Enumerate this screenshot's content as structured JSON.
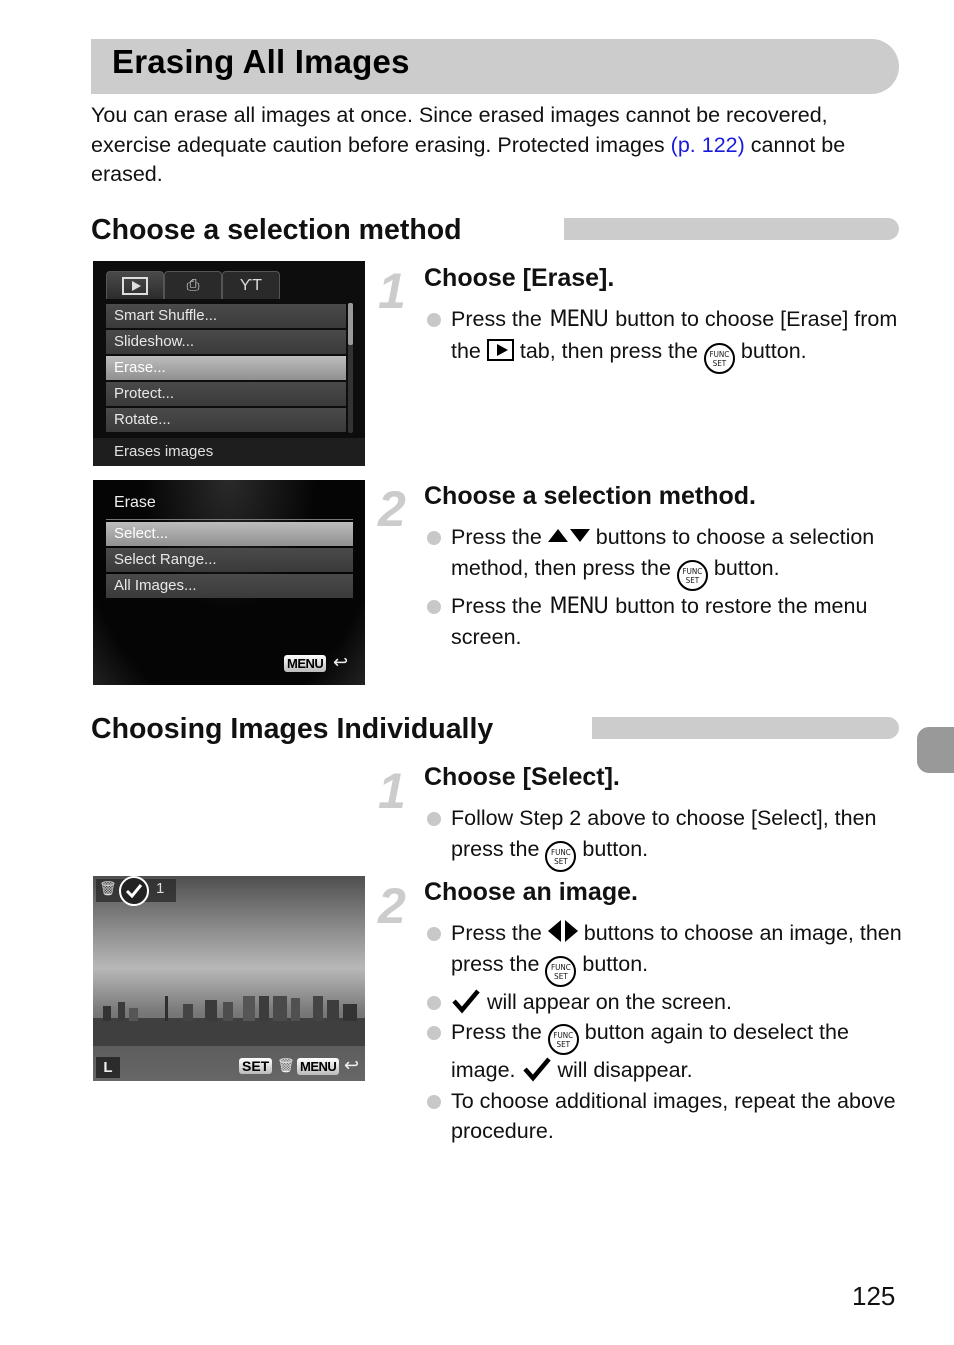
{
  "page": {
    "title": "Erasing All Images",
    "intro_part1": "You can erase all images at once. Since erased images cannot be recovered, exercise adequate caution before erasing. Protected images ",
    "intro_link": "(p. 122)",
    "intro_part2": " cannot be erased.",
    "page_number": "125"
  },
  "colors": {
    "link": "#1a1adc",
    "title_bar": "#cccccc",
    "side_tab": "#999999",
    "step_number": "#cccccc"
  },
  "section1": {
    "heading": "Choose a selection method",
    "steps": [
      {
        "number": "1",
        "title": "Choose [Erase].",
        "bullets": [
          {
            "a": "Press the ",
            "menu": "MENU",
            "b": " button to choose [Erase] from the ",
            "c": " tab, then press the ",
            "d": " button."
          }
        ]
      },
      {
        "number": "2",
        "title": "Choose a selection method.",
        "bullets": [
          {
            "a": "Press the ",
            "b": " buttons to choose a selection method, then press the ",
            "c": " button."
          },
          {
            "a": "Press the ",
            "menu": "MENU",
            "b": " button to restore the menu screen."
          }
        ]
      }
    ],
    "screen1": {
      "tabs": [
        "play-tab",
        "print-tab",
        "settings-tab"
      ],
      "tab_icons": {
        "print": "⎙",
        "settings": "ƳT"
      },
      "items": [
        "Smart Shuffle...",
        "Slideshow...",
        "Erase...",
        "Protect...",
        "Rotate..."
      ],
      "selected_index": 2,
      "hint": "Erases images"
    },
    "screen2": {
      "title": "Erase",
      "items": [
        "Select...",
        "Select Range...",
        "All Images..."
      ],
      "selected_index": 0,
      "menu_button": "MENU",
      "back_glyph": "↩"
    }
  },
  "section2": {
    "heading": "Choosing Images Individually",
    "steps": [
      {
        "number": "1",
        "title": "Choose [Select].",
        "bullets": [
          {
            "a": "Follow Step 2 above to choose [Select], then press the ",
            "b": " button."
          }
        ]
      },
      {
        "number": "2",
        "title": "Choose an image.",
        "bullets": [
          {
            "a": "Press the ",
            "b": " buttons to choose an image, then press the ",
            "c": " button."
          },
          {
            "a": " will appear on the screen."
          },
          {
            "a": "Press the ",
            "b": " button again to deselect the image. ",
            "c": " will disappear."
          },
          {
            "a": "To choose additional images, repeat the above procedure."
          }
        ]
      }
    ],
    "screen3": {
      "image_count": "1",
      "size_badge": "L",
      "set_button": "SET",
      "menu_button": "MENU",
      "back_glyph": "↩",
      "trash_glyph": "🗑"
    }
  },
  "func_icon": {
    "line1": "FUNC",
    "line2": "SET"
  }
}
